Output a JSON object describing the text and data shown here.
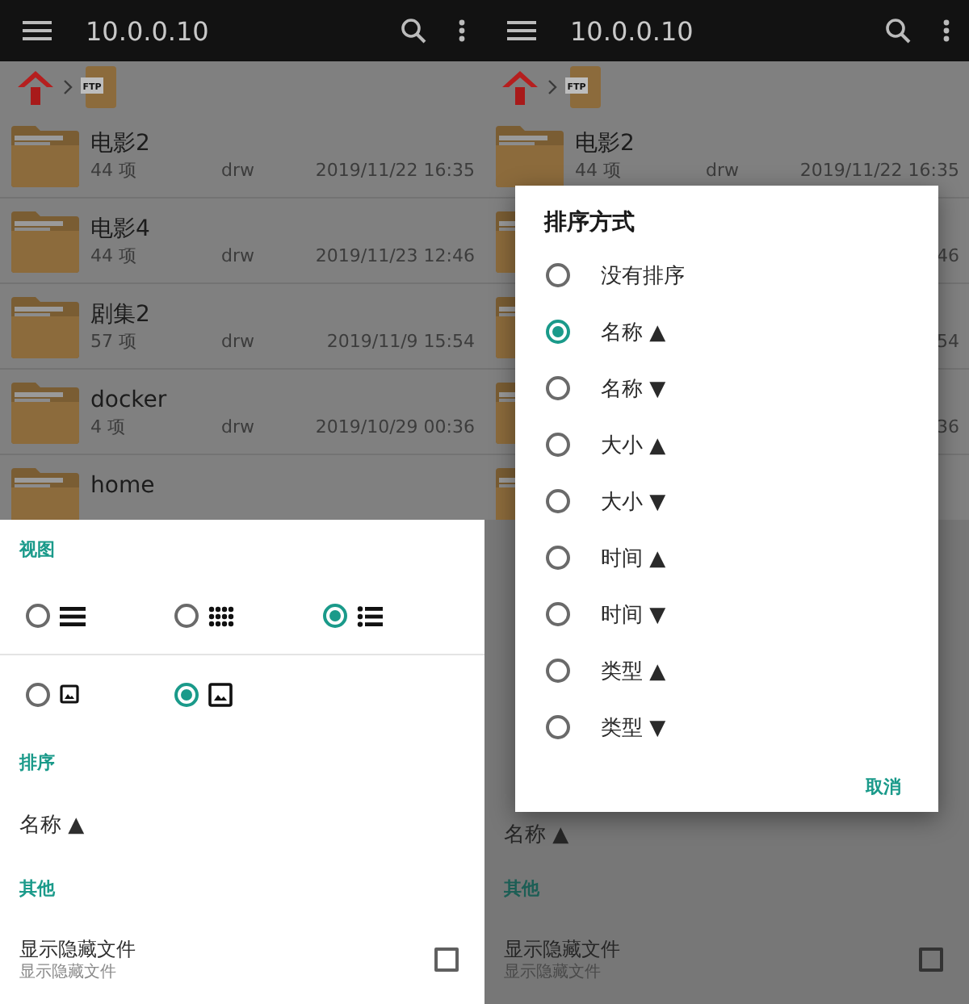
{
  "screens": [
    {
      "app_bar": {
        "title": "10.0.0.10"
      },
      "breadcrumb": {
        "folder_label": "FTP"
      },
      "files": [
        {
          "kind": "folder",
          "name": "电影2",
          "count": "44 项",
          "permissions": "drw",
          "date": "2019/11/22 16:35"
        },
        {
          "kind": "folder",
          "name": "电影4",
          "count": "44 项",
          "permissions": "drw",
          "date": "2019/11/23 12:46"
        },
        {
          "kind": "folder",
          "name": "剧集2",
          "count": "57 项",
          "permissions": "drw",
          "date": "2019/11/9 15:54"
        },
        {
          "kind": "folder",
          "name": "docker",
          "count": "4 项",
          "permissions": "drw",
          "date": "2019/10/29 00:36"
        },
        {
          "kind": "folder",
          "name": "home"
        }
      ],
      "sheet": {
        "view_title": "视图",
        "view_options": [
          [
            {
              "kind": "list",
              "selected": false
            },
            {
              "kind": "grid",
              "selected": false
            },
            {
              "kind": "detail-list",
              "selected": true
            }
          ],
          [
            {
              "kind": "small-picture",
              "selected": false
            },
            {
              "kind": "large-picture",
              "selected": true
            }
          ]
        ],
        "sort_title": "排序",
        "sort_value": "名称 ▲",
        "other_title": "其他",
        "show_hidden": {
          "label": "显示隐藏文件",
          "sublabel": "显示隐藏文件",
          "checked": false
        }
      }
    },
    {
      "app_bar": {
        "title": "10.0.0.10"
      },
      "breadcrumb": {
        "folder_label": "FTP"
      },
      "files": [
        {
          "kind": "folder",
          "name": "电影2",
          "count": "44 项",
          "permissions": "drw",
          "date": "2019/11/22 16:35"
        },
        {
          "kind": "folder",
          "date": "46"
        },
        {
          "kind": "folder",
          "date": "54"
        },
        {
          "kind": "folder",
          "date": "36"
        },
        {
          "kind": "folder"
        }
      ],
      "sheet": {
        "sort_value": "名称 ▲",
        "other_title": "其他",
        "show_hidden": {
          "label": "显示隐藏文件",
          "sublabel": "显示隐藏文件",
          "checked": false
        }
      },
      "dialog": {
        "title": "排序方式",
        "options": [
          {
            "label": "没有排序",
            "selected": false
          },
          {
            "label": "名称 ▲",
            "selected": true
          },
          {
            "label": "名称 ▼",
            "selected": false
          },
          {
            "label": "大小 ▲",
            "selected": false
          },
          {
            "label": "大小 ▼",
            "selected": false
          },
          {
            "label": "时间 ▲",
            "selected": false
          },
          {
            "label": "时间 ▼",
            "selected": false
          },
          {
            "label": "类型 ▲",
            "selected": false
          },
          {
            "label": "类型 ▼",
            "selected": false
          }
        ],
        "cancel": "取消"
      }
    }
  ]
}
